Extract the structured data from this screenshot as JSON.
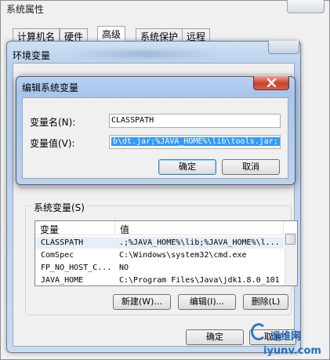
{
  "system_properties": {
    "title": "系统属性",
    "tabs": [
      "计算机名",
      "硬件",
      "高级",
      "系统保护",
      "远程"
    ],
    "active_tab": 2
  },
  "env_window": {
    "title": "环境变量",
    "system_vars_label": "系统变量(S)",
    "columns": [
      "变量",
      "值"
    ],
    "rows": [
      {
        "name": "CLASSPATH",
        "value": ".;%JAVA_HOME%\\lib;%JAVA_HOME%\\l..."
      },
      {
        "name": "ComSpec",
        "value": "C:\\Windows\\system32\\cmd.exe"
      },
      {
        "name": "FP_NO_HOST_C...",
        "value": "NO"
      },
      {
        "name": "JAVA_HOME",
        "value": "C:\\Program Files\\Java\\jdk1.8.0_101"
      }
    ],
    "buttons": {
      "new": "新建(W)...",
      "edit": "编辑(I)...",
      "delete": "删除(L)"
    },
    "ok": "确定",
    "cancel": "取消"
  },
  "edit_dialog": {
    "title": "编辑系统变量",
    "name_label": "变量名(N):",
    "name_value": "CLASSPATH",
    "value_label": "变量值(V):",
    "value_value": "b\\dt.jar;%JAVA_HOME%\\lib\\tools.jar;",
    "ok": "确定",
    "cancel": "取消"
  },
  "watermark": {
    "brand": "运维网",
    "site": "iyunv.com"
  },
  "colors": {
    "selection": "#3399ff",
    "title_glass": "#b9d1ee",
    "close_red": "#c9402a"
  }
}
